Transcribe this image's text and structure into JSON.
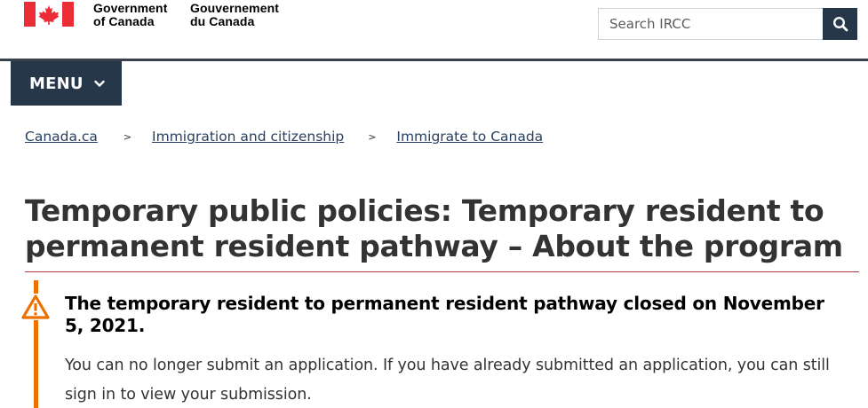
{
  "header": {
    "signature_en_line1": "Government",
    "signature_en_line2": "of Canada",
    "signature_fr_line1": "Gouvernement",
    "signature_fr_line2": "du Canada",
    "flag_color": "#eb2d37"
  },
  "search": {
    "placeholder": "Search IRCC",
    "button_icon": "search-icon"
  },
  "menu": {
    "label": "MENU",
    "icon": "chevron-down-icon"
  },
  "breadcrumb": {
    "items": [
      {
        "label": "Canada.ca"
      },
      {
        "label": "Immigration and citizenship"
      },
      {
        "label": "Immigrate to Canada"
      }
    ],
    "separator": ">"
  },
  "page": {
    "title": "Temporary public policies: Temporary resident to permanent resident pathway – About the program"
  },
  "alert": {
    "icon": "warning-icon",
    "heading": "The temporary resident to permanent resident pathway closed on November 5, 2021.",
    "body": "You can no longer submit an application. If you have already submitted an application, you can still sign in to view your submission."
  },
  "colors": {
    "primary_dark": "#26374a",
    "link": "#284162",
    "title_rule": "#af3c43",
    "warning": "#ee7100"
  }
}
